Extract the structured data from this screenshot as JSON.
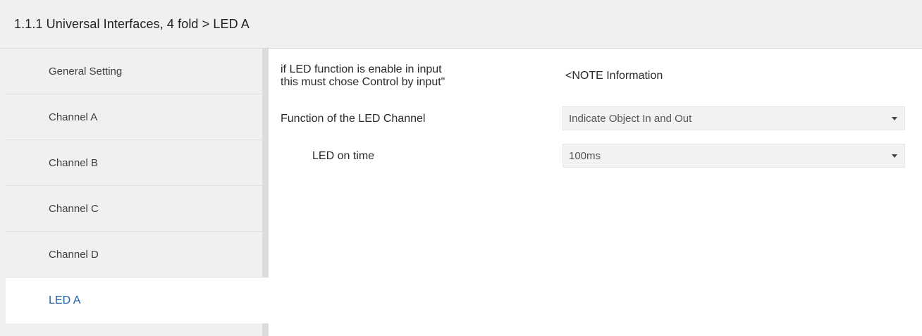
{
  "header": {
    "title": "1.1.1 Universal Interfaces, 4 fold > LED A"
  },
  "sidebar": {
    "items": [
      {
        "label": "General Setting",
        "active": false
      },
      {
        "label": "Channel A",
        "active": false
      },
      {
        "label": "Channel B",
        "active": false
      },
      {
        "label": "Channel C",
        "active": false
      },
      {
        "label": "Channel D",
        "active": false
      },
      {
        "label": "LED A",
        "active": true
      }
    ]
  },
  "main": {
    "note": {
      "label_line1": "if LED function is enable in input",
      "label_line2": "this must chose Control by input\"",
      "value": "<NOTE Information"
    },
    "function_param": {
      "label": "Function of the LED Channel",
      "value": "Indicate Object In and Out"
    },
    "on_time_param": {
      "label": "LED on time",
      "value": "100ms"
    }
  },
  "colors": {
    "active_item": "#1f5f9e",
    "panel_bg": "#f0f0f0",
    "dropdown_bg": "#f2f2f2"
  }
}
